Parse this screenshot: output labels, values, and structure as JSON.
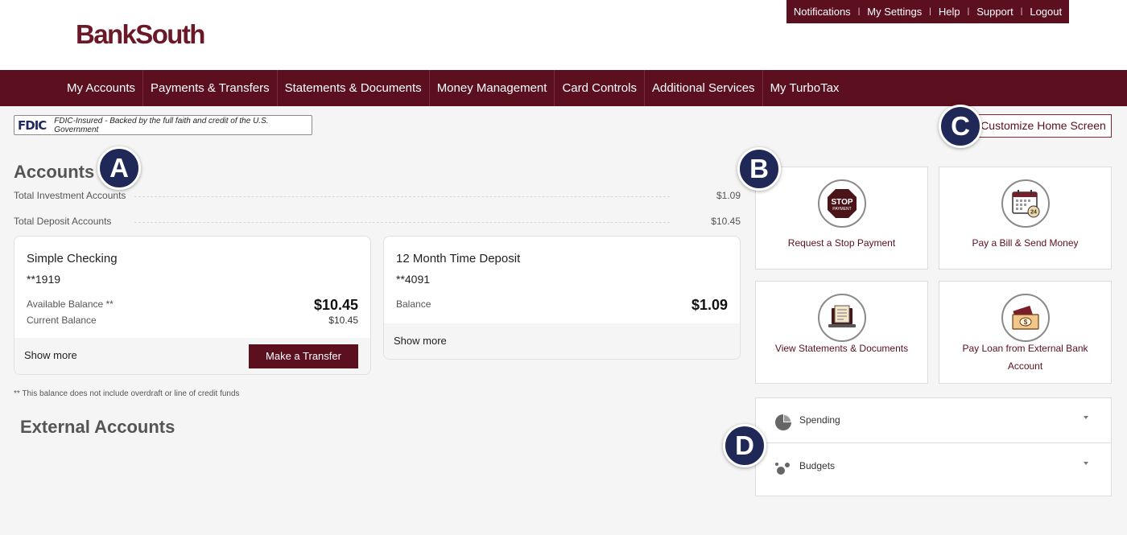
{
  "brand": {
    "name": "BankSouth",
    "color": "#6b1828"
  },
  "utility_nav": [
    {
      "label": "Notifications"
    },
    {
      "label": "My Settings"
    },
    {
      "label": "Help"
    },
    {
      "label": "Support"
    },
    {
      "label": "Logout"
    }
  ],
  "main_nav": [
    {
      "label": "My Accounts"
    },
    {
      "label": "Payments & Transfers"
    },
    {
      "label": "Statements & Documents"
    },
    {
      "label": "Money Management"
    },
    {
      "label": "Card Controls"
    },
    {
      "label": "Additional Services"
    },
    {
      "label": "My TurboTax"
    }
  ],
  "fdic": {
    "logo": "FDIC",
    "text": "FDIC-Insured - Backed by the full faith and credit of the U.S. Government"
  },
  "customize_button": "Customize Home Screen",
  "markers": {
    "a": "A",
    "b": "B",
    "c": "C",
    "d": "D"
  },
  "accounts": {
    "title": "Accounts",
    "summary": [
      {
        "label": "Total Investment Accounts",
        "value": "$1.09"
      },
      {
        "label": "Total Deposit Accounts",
        "value": "$10.45"
      }
    ],
    "cards": [
      {
        "name": "Simple Checking",
        "number": "**1919",
        "available_label": "Available Balance **",
        "available_value": "$10.45",
        "current_label": "Current Balance",
        "current_value": "$10.45",
        "show_more": "Show more",
        "action": "Make a Transfer"
      },
      {
        "name": "12 Month Time Deposit",
        "number": "**4091",
        "balance_label": "Balance",
        "balance_value": "$1.09",
        "show_more": "Show more"
      }
    ],
    "footnote": "** This balance does not include overdraft or line of credit funds"
  },
  "external_accounts": {
    "title": "External Accounts"
  },
  "quick_actions": [
    {
      "label": "Request a Stop Payment",
      "icon": "stop-payment-icon",
      "icon_text_top": "STOP",
      "icon_text_bottom": "PAYMENT"
    },
    {
      "label": "Pay a Bill & Send Money",
      "icon": "calendar-bill-icon",
      "icon_text": "24"
    },
    {
      "label": "View Statements & Documents",
      "icon": "laptop-statement-icon"
    },
    {
      "label": "Pay Loan from External Bank Account",
      "icon": "cash-envelope-icon",
      "icon_text": "$"
    }
  ],
  "widgets": [
    {
      "label": "Spending",
      "icon": "pie-chart-icon"
    },
    {
      "label": "Budgets",
      "icon": "bubbles-icon"
    }
  ],
  "colors": {
    "primary": "#5c0f1e",
    "marker": "#1f2856",
    "background": "#f5f5f5"
  }
}
